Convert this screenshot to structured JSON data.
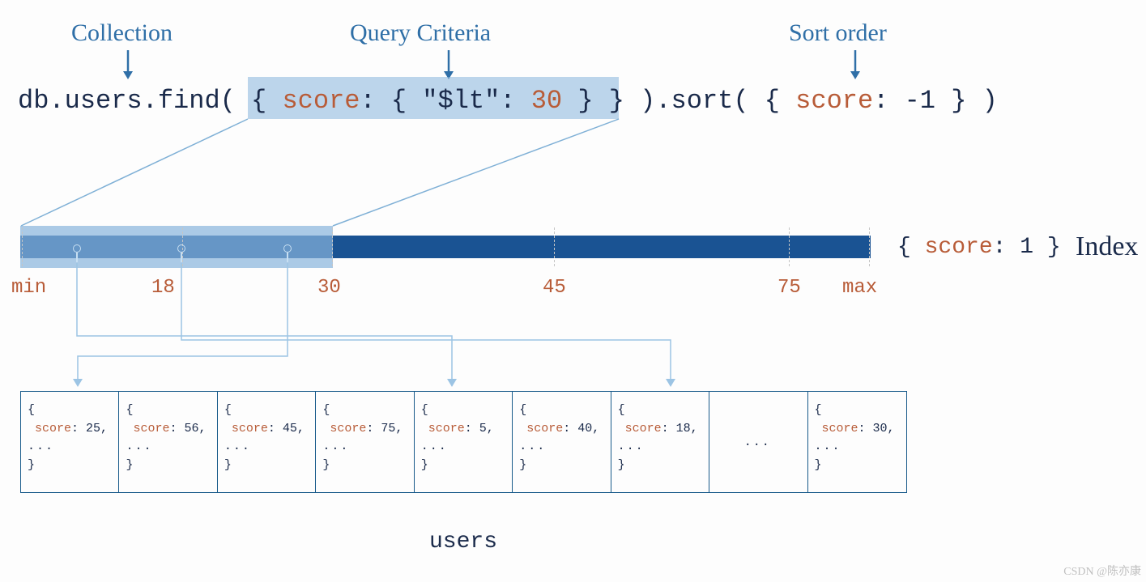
{
  "annotations": {
    "collection": "Collection",
    "queryCriteria": "Query Criteria",
    "sortOrder": "Sort order"
  },
  "query": {
    "part1": "db.users.find( ",
    "part2_open": "{ ",
    "part2_field": "score",
    "part2_colon": ": { \"$lt\": ",
    "part2_num": "30",
    "part2_close": " } }",
    "part3": " ).sort( { ",
    "part3_field": "score",
    "part3_rest": ": -1 } )"
  },
  "indexLabel": {
    "open": "{ ",
    "field": "score",
    "rest": ": 1 }",
    "word": "Index"
  },
  "ticks": {
    "min": "min",
    "t1": "18",
    "t2": "30",
    "t3": "45",
    "t4": "75",
    "max": "max"
  },
  "documents": [
    {
      "score": "25"
    },
    {
      "score": "56"
    },
    {
      "score": "45"
    },
    {
      "score": "75"
    },
    {
      "score": "5"
    },
    {
      "score": "40"
    },
    {
      "score": "18"
    },
    {
      "empty": true
    },
    {
      "score": "30"
    }
  ],
  "collectionName": "users",
  "watermark": "CSDN @陈亦康",
  "scoreLabel": "score"
}
